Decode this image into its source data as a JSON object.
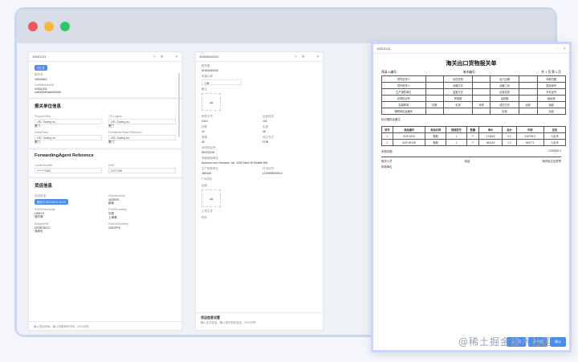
{
  "panel1": {
    "header": "10010111",
    "tag": "已汇总",
    "lbl1": "报关号",
    "val1": "49526543",
    "lbl2": "CoReferenceID",
    "val2": "01501001",
    "val2b": "cde000000ab00000e",
    "sec1": "报关单位信息",
    "f1l": "ShipperParty",
    "f1v": "LRC Trading Inc.",
    "f1v2": "厦门",
    "f2l": "TTC agent",
    "f2v": "LRC Trading Inc.",
    "f2v2": "厦门",
    "f3l": "NotifyParty",
    "f3v": "LRC Trading Inc.",
    "f3v2": "厦门",
    "f4l": "ForWarderPlaceOfReceive",
    "f4v": "LRC Trading Inc.",
    "f4v2": "厦门",
    "sec2": "ForwardingAgent Reference",
    "g1l": "LocalClearAttr",
    "g1v": "********0006",
    "g2l": "SAN",
    "g2v": "XXX**055",
    "sec3": "货运信息",
    "h1l": "状态信息",
    "h1v": "报关中 2023-09-01 12:10",
    "h2l": "ShipmentInfo",
    "h2v": "4425001",
    "h2v2": "越南",
    "h3l": "PortOfDischarge",
    "h3v": "USNYC",
    "h3v2": "纽约港",
    "h4l": "PortOfLoading",
    "h4v": "中国",
    "h4v2": "上海港",
    "h5l": "ShipperRef",
    "h5v": "UE987543 0",
    "h5v2": "深圳仓",
    "h6l": "PlaceOfDelivery",
    "h6v": "XMOPRS",
    "footer": "输入货运代码、输入所属海关代码、OCR识别"
  },
  "panel2": {
    "header": "10003040102",
    "lbl1": "报关单",
    "val1": "SHD0040002",
    "lbl2": "申报口岸",
    "val2": "上海",
    "lbl3": "备注",
    "lbl4": "贸易方式",
    "val4": "0110",
    "lbl5": "征免性质",
    "val5": "101",
    "lbl6": "件数",
    "val6": "10",
    "lbl7": "毛重",
    "val7": "45",
    "lbl8": "净重",
    "val8": "40",
    "lbl9": "成交方式",
    "val9": "FOB",
    "lbl10": "合同协议号",
    "val10": "SK001234",
    "lbl11": "消费使用单位",
    "val11": "Amazon.com Services, Inc. 1000 Main St Seattle WA",
    "lbl12": "生产销售单位",
    "val12": "JD0426",
    "lbl13": "许可证号",
    "val13": "LDXH55000012",
    "lbl14": "FTA协定",
    "lbl15": "运费",
    "lbl16": "附件",
    "upload_label": "上传文件",
    "sec": "货运信息设置",
    "footer": "输入企业信息、输入报关相关信息、OCR识别"
  },
  "doc": {
    "header": "10010111",
    "title": "海关出口货物报关单",
    "pre_no": "预录入编号：",
    "cust_no": "海关编号：",
    "page": "共 1 页 第 1 页",
    "rows": [
      [
        "境内发货人",
        "",
        "出境关别",
        "",
        "出口日期",
        "",
        "申报日期"
      ],
      [
        "境外收货人",
        "",
        "运输方式",
        "",
        "运输工具",
        "",
        "提运单号"
      ],
      [
        "生产销售单位",
        "",
        "监管方式",
        "",
        "征免性质",
        "",
        "许可证号"
      ],
      [
        "合同协议号",
        "",
        "贸易国",
        "",
        "运抵国",
        "",
        "指运港"
      ],
      [
        "包装种类",
        "件数",
        "毛重",
        "净重",
        "成交方式",
        "运费",
        "保费"
      ],
      [
        "随附单证及编号",
        "",
        "",
        "",
        "杂费",
        "",
        "杂费"
      ]
    ],
    "marks": "标记唛码及备注",
    "goods_head": [
      "项号",
      "商品编号",
      "商品名称",
      "规格型号",
      "数量",
      "单价",
      "总价",
      "币制",
      "征免"
    ],
    "goods": [
      [
        "1",
        "SUP-5310",
        "鞋靴",
        "1",
        "个",
        "174818",
        "0.0",
        "615759.9",
        "人民币"
      ],
      [
        "2",
        "SUP-5320B",
        "鞋靴",
        "1",
        "个",
        "654183",
        "1.0",
        "584774",
        "人民币"
      ]
    ],
    "total_label": "申报总额",
    "total_value": "1000000.0",
    "decl_person": "报关人员",
    "decl_unit": "申报单位",
    "phone": "电话",
    "stamp": "海关批注及签章",
    "btn1": "上一页",
    "btn2": "下一页",
    "btn3": "确认"
  },
  "watermark": "@稀土掘金技术社区"
}
